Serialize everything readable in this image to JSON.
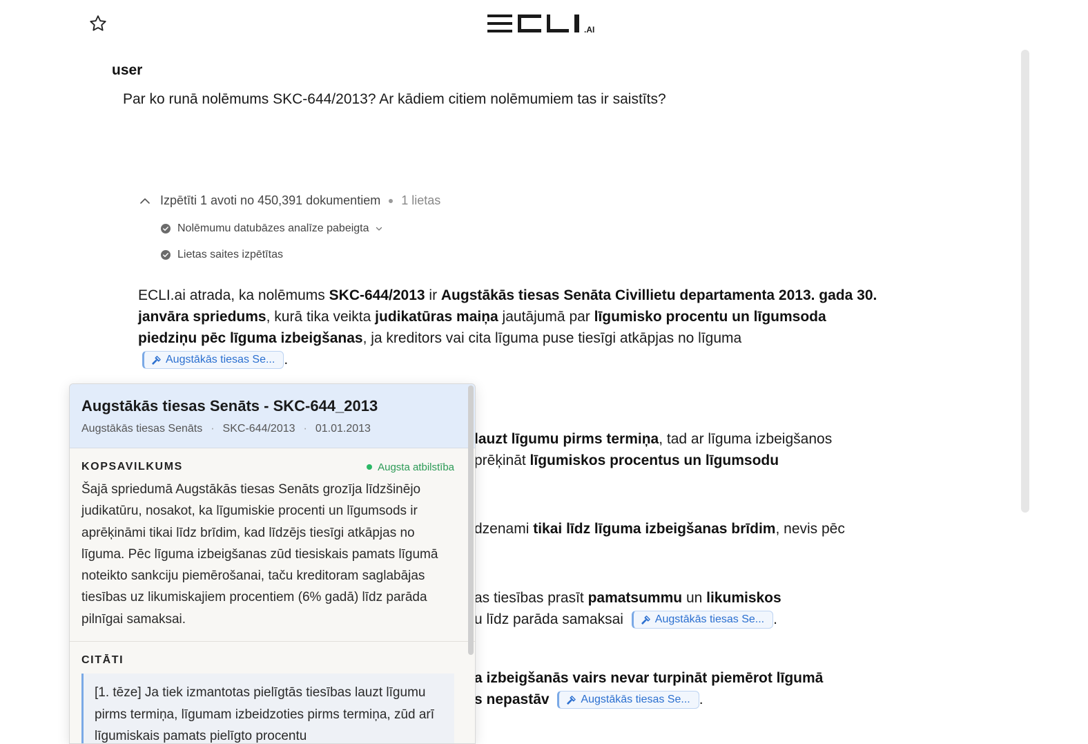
{
  "logo": {
    "text": "ECLI",
    "suffix": ".AI"
  },
  "message": {
    "role": "user",
    "question": "Par ko runā nolēmums SKC-644/2013? Ar kādiem citiem nolēmumiem tas ir saistīts?"
  },
  "research": {
    "summary": "Izpētīti 1 avoti no 450,391 dokumentiem",
    "cases": "1 lietas",
    "steps": [
      {
        "label": "Nolēmumu datubāzes analīze pabeigta"
      },
      {
        "label": "Lietas saites izpētītas"
      }
    ]
  },
  "answer": {
    "p1": {
      "t1": "ECLI.ai atrada, ka nolēmums ",
      "b1": "SKC-644/2013",
      "t2": " ir ",
      "b2": "Augstākās tiesas Senāta Civillietu departamenta 2013. gada 30. janvāra spriedums",
      "t3": ", kurā tika veikta ",
      "b3": "judikatūras maiņa",
      "t4": " jautājumā par ",
      "b4": "līgumisko procentu un līgumsoda piedziņu pēc līguma izbeigšanas",
      "t5": ", ja kreditors vai cita līguma puse tiesīgi atkāpjas no līguma",
      "t6": "."
    },
    "p2": {
      "b1": "lauzt līgumu pirms termiņa",
      "t1": ", tad ar līguma izbeigšanos",
      "t2": "prēķināt ",
      "b2": "līgumiskos procentus un līgumsodu"
    },
    "p3": {
      "t1": "dzenami ",
      "b1": "tikai līdz līguma izbeigšanas brīdim",
      "t2": ", nevis pēc"
    },
    "p4": {
      "t1": "as tiesības prasīt ",
      "b1": "pamatsummu",
      "t2": " un ",
      "b2": "likumiskos",
      "t3": "u līdz parāda samaksai",
      "t4": "."
    },
    "p5": {
      "b1": "a izbeigšanās vairs nevar turpināt piemērot līgumā",
      "b2": "s nepastāv",
      "t1": "."
    },
    "citation_label": "Augstākās tiesas Se..."
  },
  "popup": {
    "title": "Augstākās tiesas Senāts - SKC-644_2013",
    "court": "Augstākās tiesas Senāts",
    "case_no": "SKC-644/2013",
    "date": "01.01.2013",
    "summary_heading": "KOPSAVILKUMS",
    "relevance": "Augsta atbilstība",
    "summary": "Šajā spriedumā Augstākās tiesas Senāts grozīja līdzšinējo judikatūru, nosakot, ka līgumiskie procenti un līgumsods ir aprēķināmi tikai līdz brīdim, kad līdzējs tiesīgi atkāpjas no līguma. Pēc līguma izbeigšanas zūd tiesiskais pamats līgumā noteikto sankciju piemērošanai, taču kreditoram saglabājas tiesības uz likumiskajiem procentiem (6% gadā) līdz parāda pilnīgai samaksai.",
    "quotes_heading": "CITĀTI",
    "quote": "[1. tēze] Ja tiek izmantotas pielīgtās tiesības lauzt līgumu pirms termiņa, līgumam izbeidzoties pirms termiņa, zūd arī līgumiskais pamats pielīgto procentu"
  },
  "colors": {
    "accent": "#2a6fd0",
    "popup_header": "#e2ecfa",
    "relevance": "#2b9a55"
  }
}
